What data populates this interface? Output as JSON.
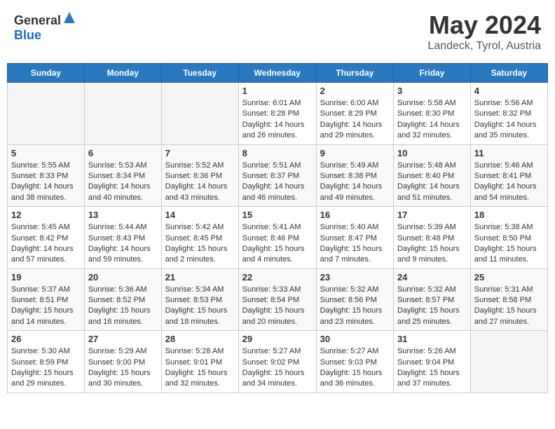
{
  "header": {
    "logo_general": "General",
    "logo_blue": "Blue",
    "month_title": "May 2024",
    "location": "Landeck, Tyrol, Austria"
  },
  "days_of_week": [
    "Sunday",
    "Monday",
    "Tuesday",
    "Wednesday",
    "Thursday",
    "Friday",
    "Saturday"
  ],
  "weeks": [
    [
      {
        "day": "",
        "info": ""
      },
      {
        "day": "",
        "info": ""
      },
      {
        "day": "",
        "info": ""
      },
      {
        "day": "1",
        "info": "Sunrise: 6:01 AM\nSunset: 8:28 PM\nDaylight: 14 hours and 26 minutes."
      },
      {
        "day": "2",
        "info": "Sunrise: 6:00 AM\nSunset: 8:29 PM\nDaylight: 14 hours and 29 minutes."
      },
      {
        "day": "3",
        "info": "Sunrise: 5:58 AM\nSunset: 8:30 PM\nDaylight: 14 hours and 32 minutes."
      },
      {
        "day": "4",
        "info": "Sunrise: 5:56 AM\nSunset: 8:32 PM\nDaylight: 14 hours and 35 minutes."
      }
    ],
    [
      {
        "day": "5",
        "info": "Sunrise: 5:55 AM\nSunset: 8:33 PM\nDaylight: 14 hours and 38 minutes."
      },
      {
        "day": "6",
        "info": "Sunrise: 5:53 AM\nSunset: 8:34 PM\nDaylight: 14 hours and 40 minutes."
      },
      {
        "day": "7",
        "info": "Sunrise: 5:52 AM\nSunset: 8:36 PM\nDaylight: 14 hours and 43 minutes."
      },
      {
        "day": "8",
        "info": "Sunrise: 5:51 AM\nSunset: 8:37 PM\nDaylight: 14 hours and 46 minutes."
      },
      {
        "day": "9",
        "info": "Sunrise: 5:49 AM\nSunset: 8:38 PM\nDaylight: 14 hours and 49 minutes."
      },
      {
        "day": "10",
        "info": "Sunrise: 5:48 AM\nSunset: 8:40 PM\nDaylight: 14 hours and 51 minutes."
      },
      {
        "day": "11",
        "info": "Sunrise: 5:46 AM\nSunset: 8:41 PM\nDaylight: 14 hours and 54 minutes."
      }
    ],
    [
      {
        "day": "12",
        "info": "Sunrise: 5:45 AM\nSunset: 8:42 PM\nDaylight: 14 hours and 57 minutes."
      },
      {
        "day": "13",
        "info": "Sunrise: 5:44 AM\nSunset: 8:43 PM\nDaylight: 14 hours and 59 minutes."
      },
      {
        "day": "14",
        "info": "Sunrise: 5:42 AM\nSunset: 8:45 PM\nDaylight: 15 hours and 2 minutes."
      },
      {
        "day": "15",
        "info": "Sunrise: 5:41 AM\nSunset: 8:46 PM\nDaylight: 15 hours and 4 minutes."
      },
      {
        "day": "16",
        "info": "Sunrise: 5:40 AM\nSunset: 8:47 PM\nDaylight: 15 hours and 7 minutes."
      },
      {
        "day": "17",
        "info": "Sunrise: 5:39 AM\nSunset: 8:48 PM\nDaylight: 15 hours and 9 minutes."
      },
      {
        "day": "18",
        "info": "Sunrise: 5:38 AM\nSunset: 8:50 PM\nDaylight: 15 hours and 11 minutes."
      }
    ],
    [
      {
        "day": "19",
        "info": "Sunrise: 5:37 AM\nSunset: 8:51 PM\nDaylight: 15 hours and 14 minutes."
      },
      {
        "day": "20",
        "info": "Sunrise: 5:36 AM\nSunset: 8:52 PM\nDaylight: 15 hours and 16 minutes."
      },
      {
        "day": "21",
        "info": "Sunrise: 5:34 AM\nSunset: 8:53 PM\nDaylight: 15 hours and 18 minutes."
      },
      {
        "day": "22",
        "info": "Sunrise: 5:33 AM\nSunset: 8:54 PM\nDaylight: 15 hours and 20 minutes."
      },
      {
        "day": "23",
        "info": "Sunrise: 5:32 AM\nSunset: 8:56 PM\nDaylight: 15 hours and 23 minutes."
      },
      {
        "day": "24",
        "info": "Sunrise: 5:32 AM\nSunset: 8:57 PM\nDaylight: 15 hours and 25 minutes."
      },
      {
        "day": "25",
        "info": "Sunrise: 5:31 AM\nSunset: 8:58 PM\nDaylight: 15 hours and 27 minutes."
      }
    ],
    [
      {
        "day": "26",
        "info": "Sunrise: 5:30 AM\nSunset: 8:59 PM\nDaylight: 15 hours and 29 minutes."
      },
      {
        "day": "27",
        "info": "Sunrise: 5:29 AM\nSunset: 9:00 PM\nDaylight: 15 hours and 30 minutes."
      },
      {
        "day": "28",
        "info": "Sunrise: 5:28 AM\nSunset: 9:01 PM\nDaylight: 15 hours and 32 minutes."
      },
      {
        "day": "29",
        "info": "Sunrise: 5:27 AM\nSunset: 9:02 PM\nDaylight: 15 hours and 34 minutes."
      },
      {
        "day": "30",
        "info": "Sunrise: 5:27 AM\nSunset: 9:03 PM\nDaylight: 15 hours and 36 minutes."
      },
      {
        "day": "31",
        "info": "Sunrise: 5:26 AM\nSunset: 9:04 PM\nDaylight: 15 hours and 37 minutes."
      },
      {
        "day": "",
        "info": ""
      }
    ]
  ]
}
